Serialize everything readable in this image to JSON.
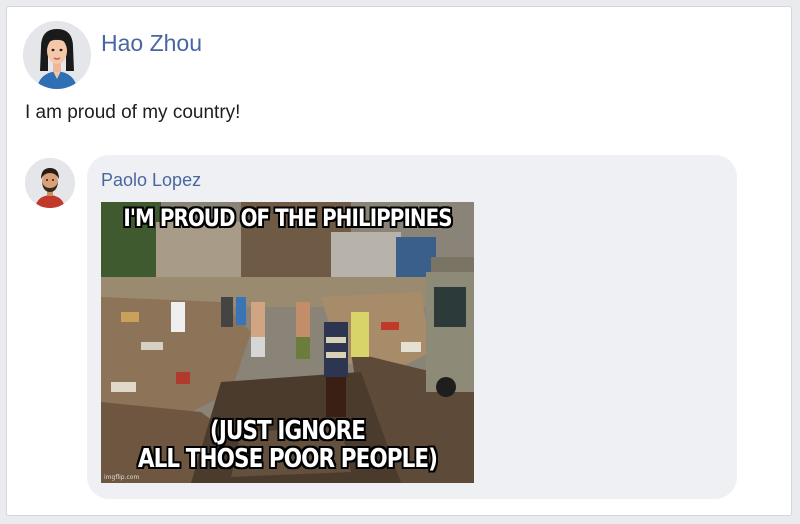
{
  "post": {
    "author_name": "Hao Zhou",
    "text": "I am proud of my country!"
  },
  "comment": {
    "author_name": "Paolo Lopez",
    "meme": {
      "top_text": "I'M PROUD OF THE PHILIPPINES",
      "bottom_line_1": "(JUST IGNORE",
      "bottom_line_2": "ALL THOSE POOR PEOPLE)",
      "watermark": "imgflip.com"
    }
  },
  "colors": {
    "link": "#4a66a0",
    "bubble": "#eff0f3",
    "card": "#ffffff",
    "page_bg": "#e9ebee"
  }
}
